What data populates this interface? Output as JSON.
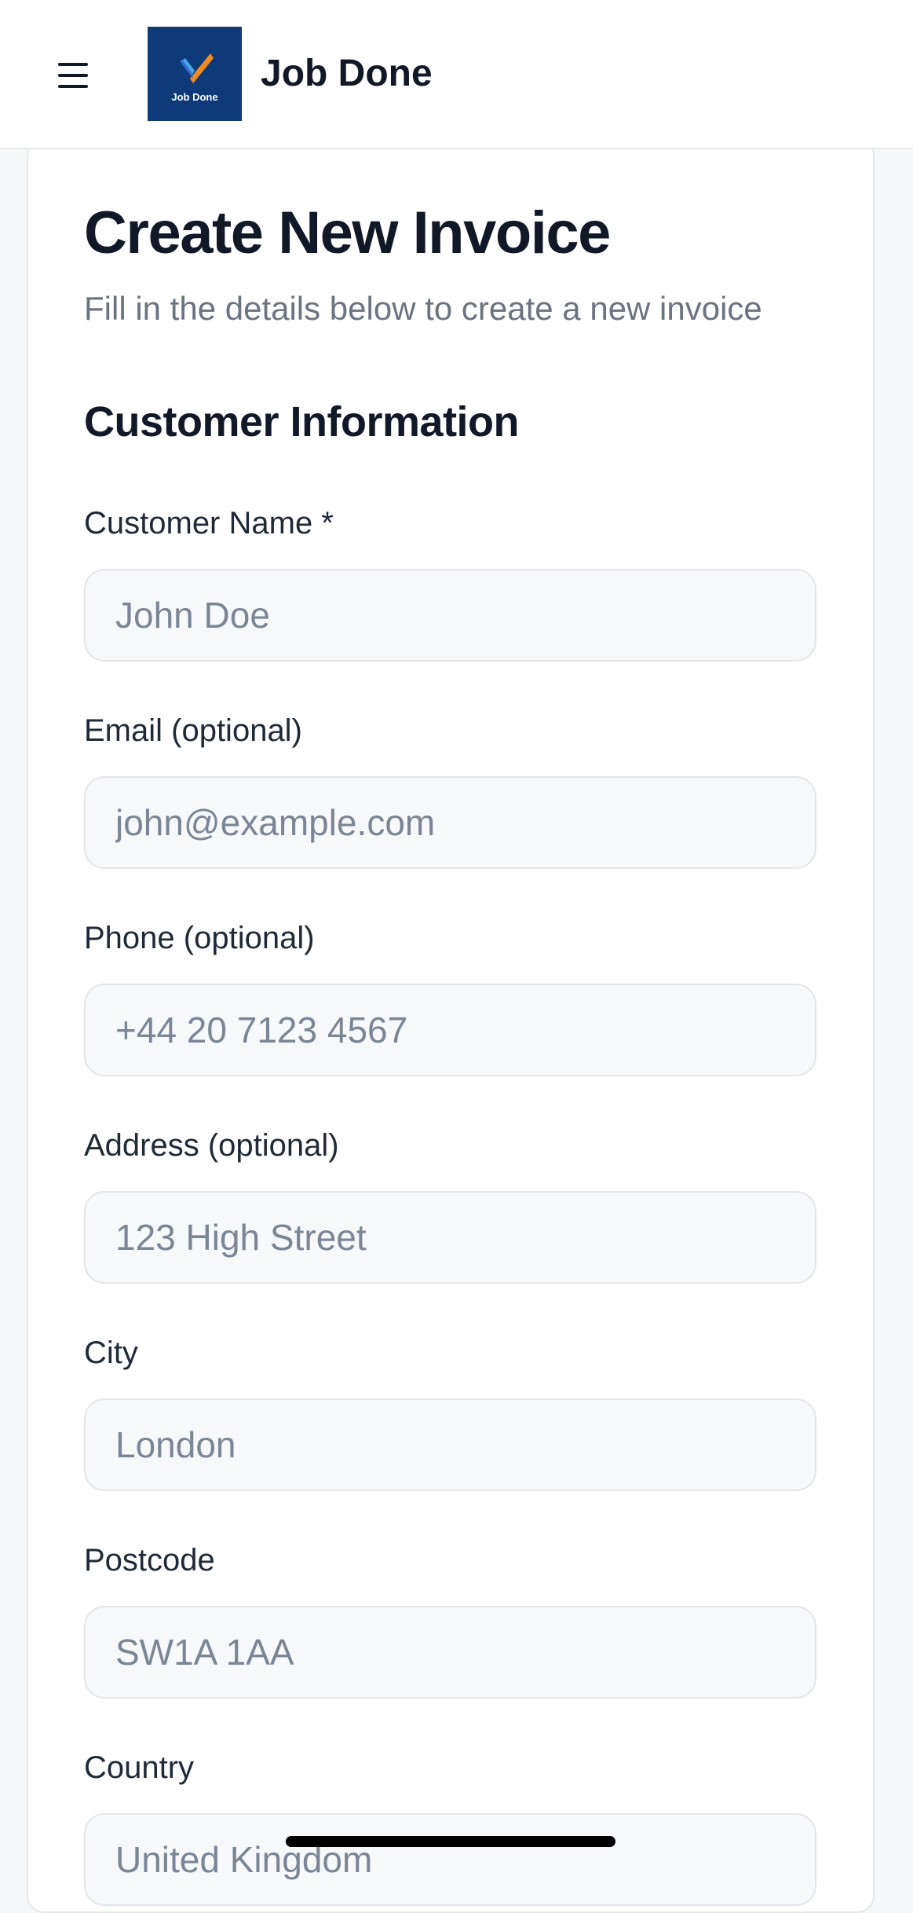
{
  "header": {
    "brand_name": "Job Done",
    "logo_text": "Job Done",
    "menu_icon": "hamburger-menu-icon",
    "colors": {
      "logo_background": "#0e3a7a",
      "logo_check_orange": "#f08a24",
      "logo_check_blue": "#4aa3ea"
    }
  },
  "page": {
    "title": "Create New Invoice",
    "subtitle": "Fill in the details below to create a new invoice"
  },
  "customer_section": {
    "title": "Customer Information",
    "fields": {
      "name": {
        "label": "Customer Name *",
        "placeholder": "John Doe",
        "value": ""
      },
      "email": {
        "label": "Email (optional)",
        "placeholder": "john@example.com",
        "value": ""
      },
      "phone": {
        "label": "Phone (optional)",
        "placeholder": "+44 20 7123 4567",
        "value": ""
      },
      "address": {
        "label": "Address (optional)",
        "placeholder": "123 High Street",
        "value": ""
      },
      "city": {
        "label": "City",
        "placeholder": "London",
        "value": ""
      },
      "postcode": {
        "label": "Postcode",
        "placeholder": "SW1A 1AA",
        "value": ""
      },
      "country": {
        "label": "Country",
        "placeholder": "United Kingdom",
        "value": ""
      }
    }
  }
}
